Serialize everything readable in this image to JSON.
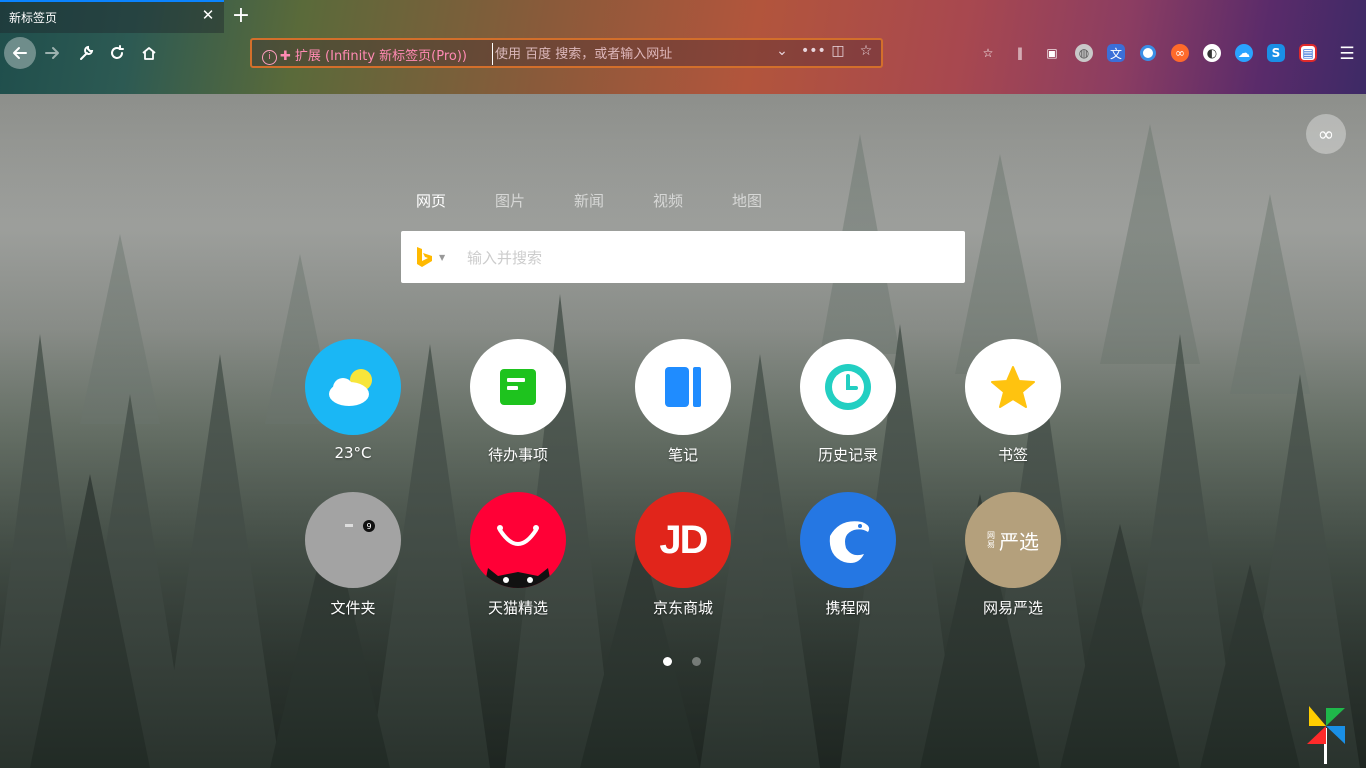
{
  "tab": {
    "title": "新标签页",
    "close": "✕",
    "new_tab": "+"
  },
  "nav": {
    "back": "←",
    "forward": "→",
    "tools": "🔧",
    "reload": "↻",
    "home": "⌂"
  },
  "urlbar": {
    "identity": "扩展 (Infinity 新标签页(Pro))",
    "placeholder": "使用 百度 搜索，或者输入网址",
    "more": "•••"
  },
  "search": {
    "tabs": [
      "网页",
      "图片",
      "新闻",
      "视频",
      "地图"
    ],
    "active_tab": "网页",
    "placeholder": "输入并搜索",
    "engine_icon": "bing-icon"
  },
  "tiles": [
    {
      "label": "23°C",
      "icon": "weather-icon",
      "bg": "#1ab7f5"
    },
    {
      "label": "待办事项",
      "icon": "todo-icon",
      "bg": "#ffffff"
    },
    {
      "label": "笔记",
      "icon": "notes-icon",
      "bg": "#ffffff"
    },
    {
      "label": "历史记录",
      "icon": "history-icon",
      "bg": "#ffffff"
    },
    {
      "label": "书签",
      "icon": "bookmark-star-icon",
      "bg": "#ffffff"
    },
    {
      "label": "文件夹",
      "icon": "folder-icon",
      "bg": "#a3a3a3"
    },
    {
      "label": "天猫精选",
      "icon": "tmall-icon",
      "bg": "#ff0036"
    },
    {
      "label": "京东商城",
      "icon": "jd-icon",
      "bg": "#e1251b",
      "text": "JD"
    },
    {
      "label": "携程网",
      "icon": "ctrip-icon",
      "bg": "#2577e3"
    },
    {
      "label": "网易严选",
      "icon": "yanxuan-icon",
      "bg": "#b4a07c",
      "text": "严选",
      "small_text": "网易"
    }
  ],
  "pager": {
    "count": 2,
    "active": 0
  },
  "infinity_button": "∞",
  "colors": {
    "urlbar_border": "#d36f2b",
    "tab_accent": "#0a84ff",
    "identity_text": "#ff8ab3"
  }
}
